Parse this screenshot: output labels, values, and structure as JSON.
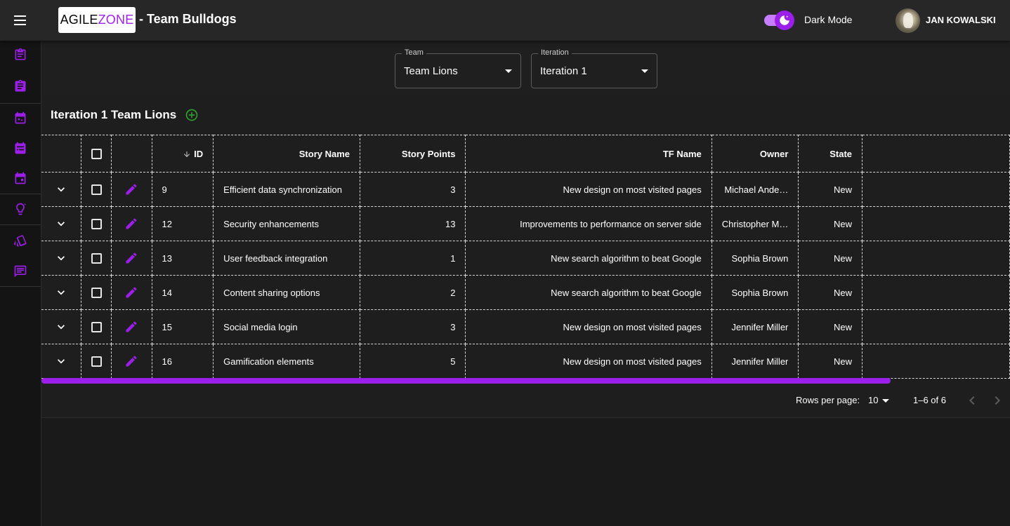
{
  "header": {
    "logo_part1": "AGILE",
    "logo_part2": "ZONE",
    "title": "- Team Bulldogs",
    "dark_mode_label": "Dark Mode",
    "user_name": "JAN KOWALSKI"
  },
  "sidebar": {
    "items": [
      {
        "icon": "clipboard-outline-icon"
      },
      {
        "icon": "clipboard-filled-icon"
      },
      {
        "icon": "calendar-sprint-icon"
      },
      {
        "icon": "calendar-filled-icon"
      },
      {
        "icon": "calendar-event-icon"
      },
      {
        "icon": "lightbulb-icon"
      },
      {
        "icon": "cards-icon"
      },
      {
        "icon": "feedback-icon"
      }
    ]
  },
  "filters": {
    "team": {
      "label": "Team",
      "value": "Team Lions"
    },
    "iteration": {
      "label": "Iteration",
      "value": "Iteration 1"
    }
  },
  "card": {
    "title": "Iteration 1 Team Lions"
  },
  "table": {
    "columns": [
      "ID",
      "Story Name",
      "Story Points",
      "TF Name",
      "Owner",
      "State"
    ],
    "rows": [
      {
        "id": "9",
        "story_name": "Efficient data synchronization",
        "story_points": "3",
        "tf_name": "New design on most visited pages",
        "owner": "Michael Ande…",
        "state": "New"
      },
      {
        "id": "12",
        "story_name": "Security enhancements",
        "story_points": "13",
        "tf_name": "Improvements to performance on server side",
        "owner": "Christopher M…",
        "state": "New"
      },
      {
        "id": "13",
        "story_name": "User feedback integration",
        "story_points": "1",
        "tf_name": "New search algorithm to beat Google",
        "owner": "Sophia Brown",
        "state": "New"
      },
      {
        "id": "14",
        "story_name": "Content sharing options",
        "story_points": "2",
        "tf_name": "New search algorithm to beat Google",
        "owner": "Sophia Brown",
        "state": "New"
      },
      {
        "id": "15",
        "story_name": "Social media login",
        "story_points": "3",
        "tf_name": "New design on most visited pages",
        "owner": "Jennifer Miller",
        "state": "New"
      },
      {
        "id": "16",
        "story_name": "Gamification elements",
        "story_points": "5",
        "tf_name": "New design on most visited pages",
        "owner": "Jennifer Miller",
        "state": "New"
      }
    ]
  },
  "pagination": {
    "rows_per_page_label": "Rows per page:",
    "rows_per_page": "10",
    "range": "1–6 of 6"
  },
  "colors": {
    "accent": "#9b1fe8",
    "add_green": "#2e9e2e",
    "background": "#1a1a1a"
  }
}
